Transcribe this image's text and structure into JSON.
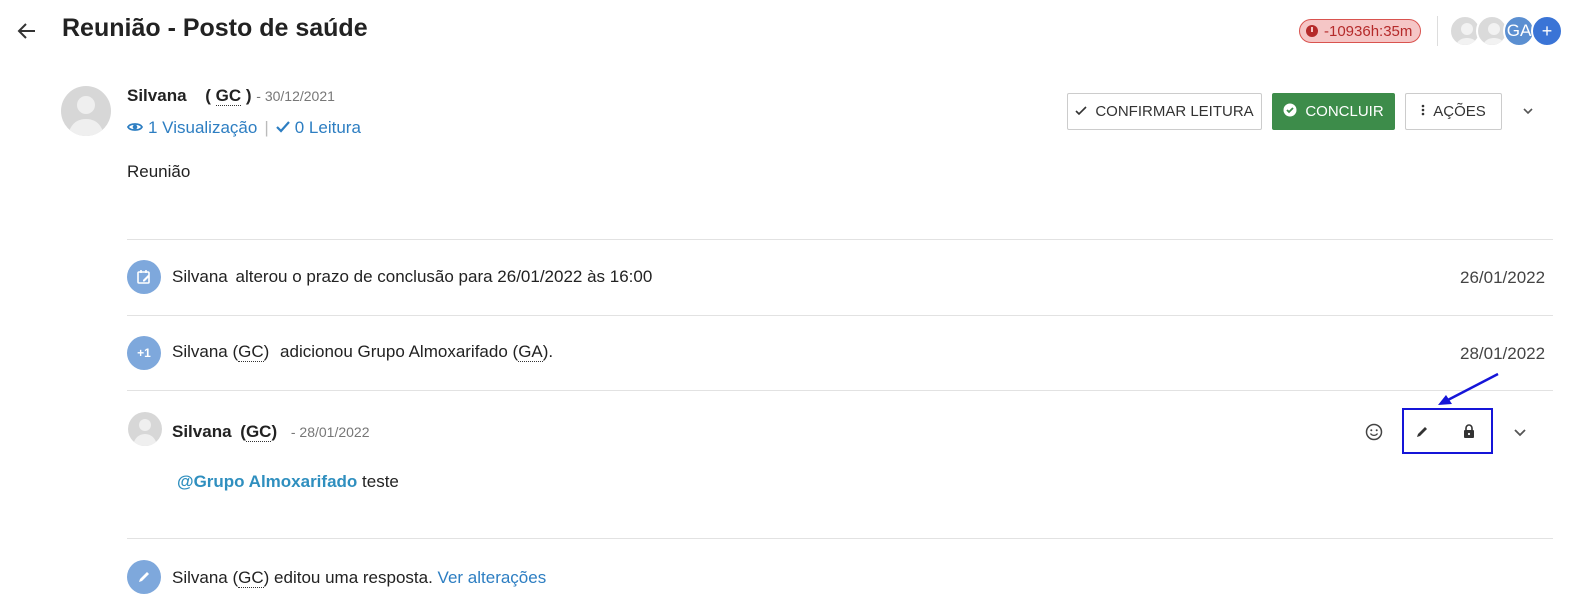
{
  "header": {
    "title": "Reunião - Posto de saúde",
    "timer": "-10936h:35m",
    "group_avatar": "GA",
    "add_label": "+"
  },
  "post": {
    "author": "Silvana",
    "abbr_open": "( ",
    "abbr": "GC",
    "abbr_close": " )",
    "date": " - 30/12/2021",
    "views": "1 Visualização",
    "reads": "0 Leitura",
    "body": "Reunião"
  },
  "actions": {
    "confirm": "CONFIRMAR LEITURA",
    "done": "CONCLUIR",
    "more": "AÇÕES"
  },
  "timeline": {
    "event1": {
      "author": "Silvana",
      "text": "alterou o prazo de conclusão para 26/01/2022 às 16:00",
      "date": "26/01/2022"
    },
    "event2": {
      "icon_text": "+1",
      "author": "Silvana",
      "abbr": "GC",
      "text_before": "adicionou Grupo Almoxarifado (",
      "abbr2": "GA",
      "text_after": ").",
      "date": "28/01/2022"
    },
    "comment": {
      "author": "Silvana",
      "abbr": "GC",
      "date": "- 28/01/2022",
      "mention": "@Grupo Almoxarifado",
      "text": "teste"
    },
    "event3": {
      "author": "Silvana",
      "abbr": "GC",
      "text": "editou uma resposta.",
      "link": "Ver alterações"
    }
  },
  "colors": {
    "accent": "#2d7ec2",
    "success": "#3d8c4a",
    "timer_bg": "#f5c6c6",
    "timer_text": "#b52a2a",
    "highlight": "#1515d8"
  },
  "icons": [
    "back-arrow-icon",
    "clock-icon",
    "eye-icon",
    "check-icon",
    "calendar-edit-icon",
    "emoji-icon",
    "pencil-icon",
    "lock-icon",
    "chevron-down-icon",
    "more-vert-icon"
  ]
}
